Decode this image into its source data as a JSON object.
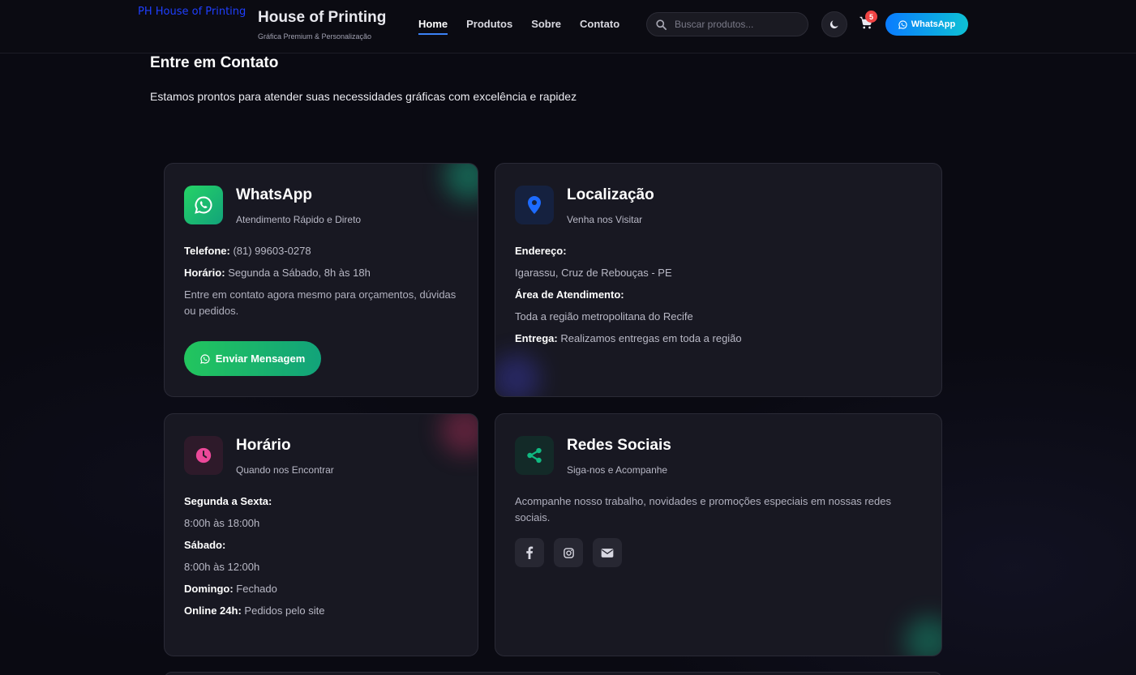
{
  "header": {
    "logo_alt": "PH House of Printing",
    "brand_title": "House of Printing",
    "brand_subtitle": "Gráfica Premium & Personalização",
    "nav": [
      {
        "label": "Home"
      },
      {
        "label": "Produtos"
      },
      {
        "label": "Sobre"
      },
      {
        "label": "Contato"
      }
    ],
    "search_placeholder": "Buscar produtos...",
    "cart_count": "5",
    "whatsapp_label": "WhatsApp"
  },
  "section": {
    "title": "Entre em Contato",
    "description": "Estamos prontos para atender suas necessidades gráficas com excelência e rapidez"
  },
  "cards": {
    "whatsapp": {
      "title": "WhatsApp",
      "subtitle": "Atendimento Rápido e Direto",
      "phone_label": "Telefone:",
      "phone_value": "(81) 99603-0278",
      "hours_label": "Horário:",
      "hours_value": "Segunda a Sábado, 8h às 18h",
      "text": "Entre em contato agora mesmo para orçamentos, dúvidas ou pedidos.",
      "button_label": "Enviar Mensagem"
    },
    "location": {
      "title": "Localização",
      "subtitle": "Venha nos Visitar",
      "address_label": "Endereço:",
      "address_value": "Igarassu, Cruz de Rebouças - PE",
      "area_label": "Área de Atendimento:",
      "area_value": "Toda a região metropolitana do Recife",
      "delivery_label": "Entrega:",
      "delivery_value": "Realizamos entregas em toda a região"
    },
    "hours": {
      "title": "Horário",
      "subtitle": "Quando nos Encontrar",
      "weekdays_label": "Segunda a Sexta:",
      "weekdays_value": "8:00h às 18:00h",
      "saturday_label": "Sábado:",
      "saturday_value": "8:00h às 12:00h",
      "sunday_label": "Domingo:",
      "sunday_value": "Fechado",
      "online_label": "Online 24h:",
      "online_value": "Pedidos pelo site"
    },
    "social": {
      "title": "Redes Sociais",
      "subtitle": "Siga-nos e Acompanhe",
      "text": "Acompanhe nosso trabalho, novidades e promoções especiais em nossas redes sociais.",
      "icons": [
        "facebook-icon",
        "instagram-icon",
        "email-icon"
      ]
    }
  },
  "colors": {
    "accent_blue": "#3b82f6",
    "whatsapp_green": "#22c55e",
    "location_blue": "#2563eb",
    "hours_pink": "#ec4899",
    "social_teal": "#10b981",
    "cart_badge": "#ef4444"
  }
}
